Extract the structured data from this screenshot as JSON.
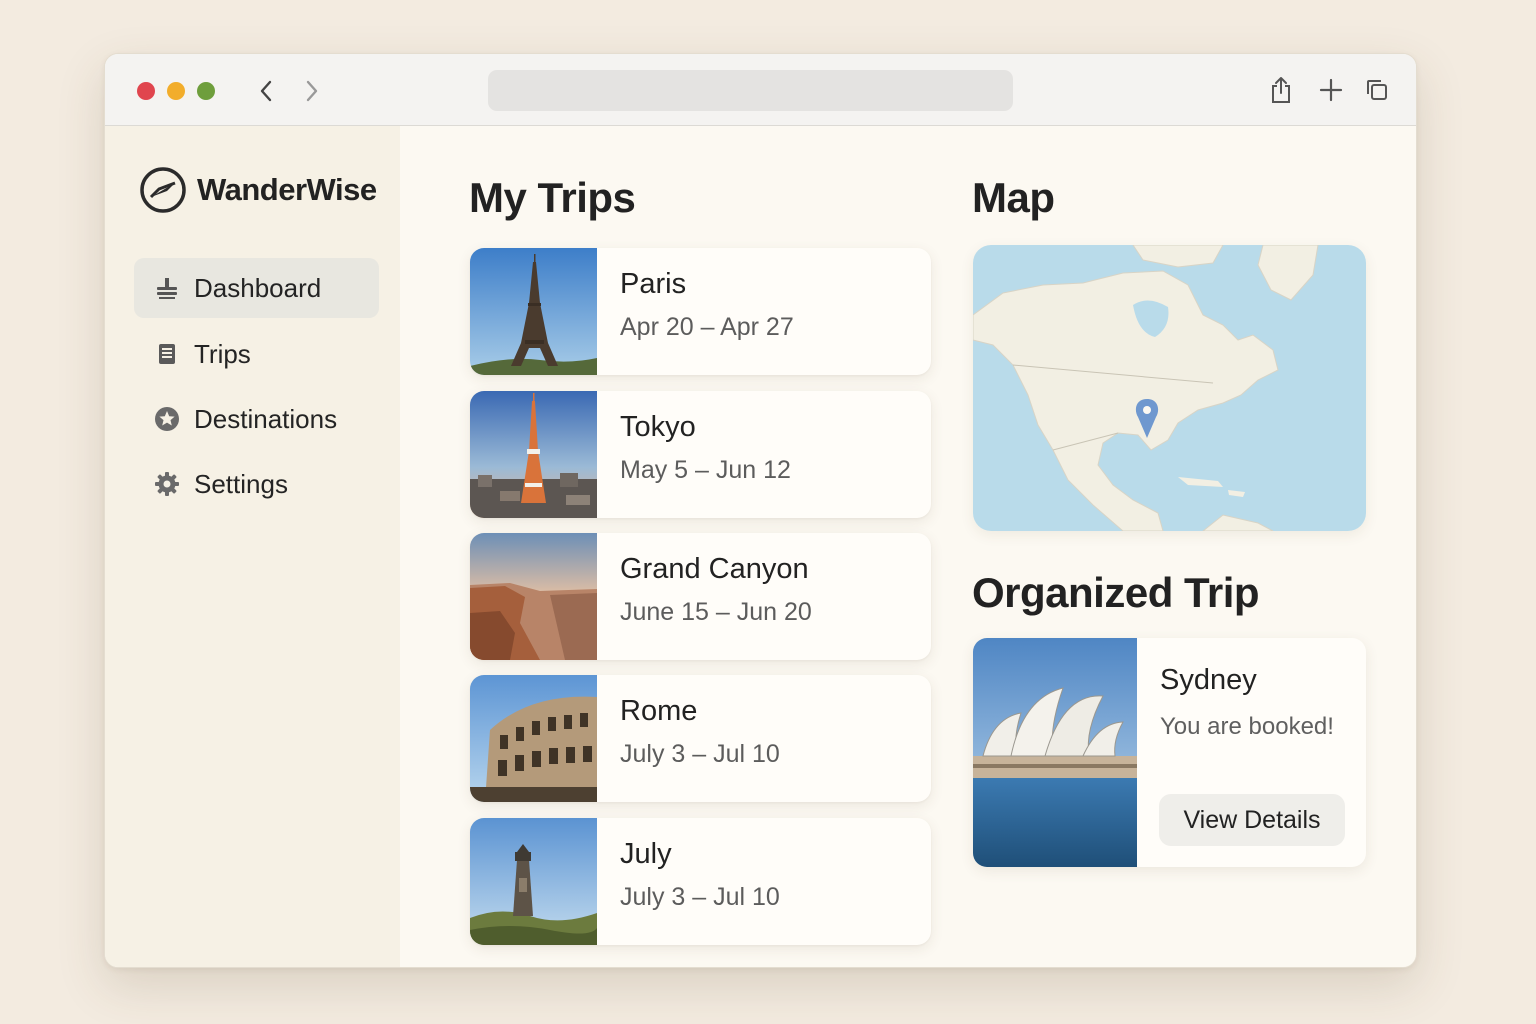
{
  "browser": {
    "controls": [
      "close",
      "minimize",
      "zoom"
    ],
    "icons": [
      "back-icon",
      "forward-icon",
      "share-icon",
      "new-tab-icon",
      "tabs-overview-icon"
    ],
    "colors": {
      "close": "#e0454e",
      "minimize": "#f2ad2b",
      "zoom": "#6e9e3c"
    }
  },
  "sidebar": {
    "brand": {
      "name": "WanderWise",
      "icon": "compass-icon"
    },
    "items": [
      {
        "label": "Dashboard",
        "icon": "dashboard-icon",
        "active": true
      },
      {
        "label": "Trips",
        "icon": "trips-icon",
        "active": false
      },
      {
        "label": "Destinations",
        "icon": "star-icon",
        "active": false
      },
      {
        "label": "Settings",
        "icon": "gear-icon",
        "active": false
      }
    ]
  },
  "main": {
    "trips_title": "My Trips",
    "trips": [
      {
        "name": "Paris",
        "dates": "Apr 20 – Apr 27",
        "image": "eiffel-tower-photo"
      },
      {
        "name": "Tokyo",
        "dates": "May 5 – Jun 12",
        "image": "tokyo-tower-photo"
      },
      {
        "name": "Grand Canyon",
        "dates": "June 15 – Jun 20",
        "image": "grand-canyon-photo"
      },
      {
        "name": "Rome",
        "dates": "July 3 – Jul 10",
        "image": "colosseum-photo"
      },
      {
        "name": "July",
        "dates": "July 3 – Jul 10",
        "image": "lighthouse-photo"
      }
    ],
    "map_title": "Map",
    "map": {
      "icon": "map-pin-icon",
      "pin_color": "#6f98cf",
      "water_color": "#b9dbea",
      "land_color": "#f2efe3"
    },
    "organized_title": "Organized Trip",
    "organized": {
      "city": "Sydney",
      "status": "You are booked!",
      "button": "View Details",
      "image": "sydney-opera-house-photo"
    }
  }
}
